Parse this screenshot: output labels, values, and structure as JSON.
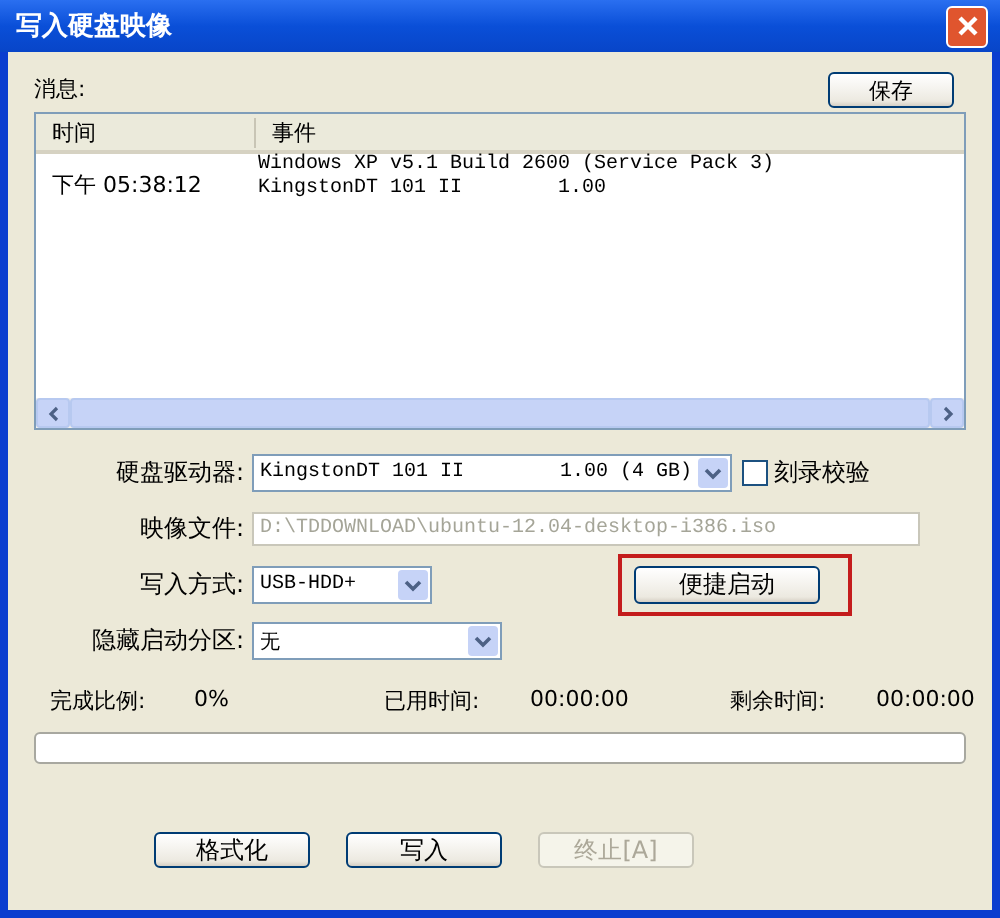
{
  "window": {
    "title": "写入硬盘映像"
  },
  "messages": {
    "label": "消息:",
    "save_button": "保存",
    "columns": [
      "时间",
      "事件"
    ],
    "rows": [
      {
        "time": "下午 05:38:12",
        "lines": [
          "Windows XP v5.1 Build 2600 (Service Pack 3)",
          "KingstonDT 101 II        1.00"
        ]
      }
    ]
  },
  "form": [
    {
      "kind": "select",
      "label": "硬盘驱动器:",
      "value": "KingstonDT 101 II        1.00 (4 GB)",
      "checkbox": {
        "label": "刻录校验",
        "checked": false
      }
    },
    {
      "kind": "text",
      "label": "映像文件:",
      "value": "D:\\TDDOWNLOAD\\ubuntu-12.04-desktop-i386.iso",
      "disabled": true
    },
    {
      "kind": "select",
      "label": "写入方式:",
      "value": "USB-HDD+",
      "button": {
        "label": "便捷启动",
        "highlighted": true
      }
    },
    {
      "kind": "select",
      "label": "隐藏启动分区:",
      "value": "无"
    }
  ],
  "progress": {
    "items": [
      {
        "label": "完成比例:",
        "value": "0%"
      },
      {
        "label": "已用时间:",
        "value": "00:00:00"
      },
      {
        "label": "剩余时间:",
        "value": "00:00:00"
      }
    ],
    "level": 0
  },
  "buttons": [
    {
      "label": "格式化",
      "disabled": false
    },
    {
      "label": "写入",
      "disabled": false
    },
    {
      "label": "终止[A]",
      "disabled": true
    }
  ]
}
